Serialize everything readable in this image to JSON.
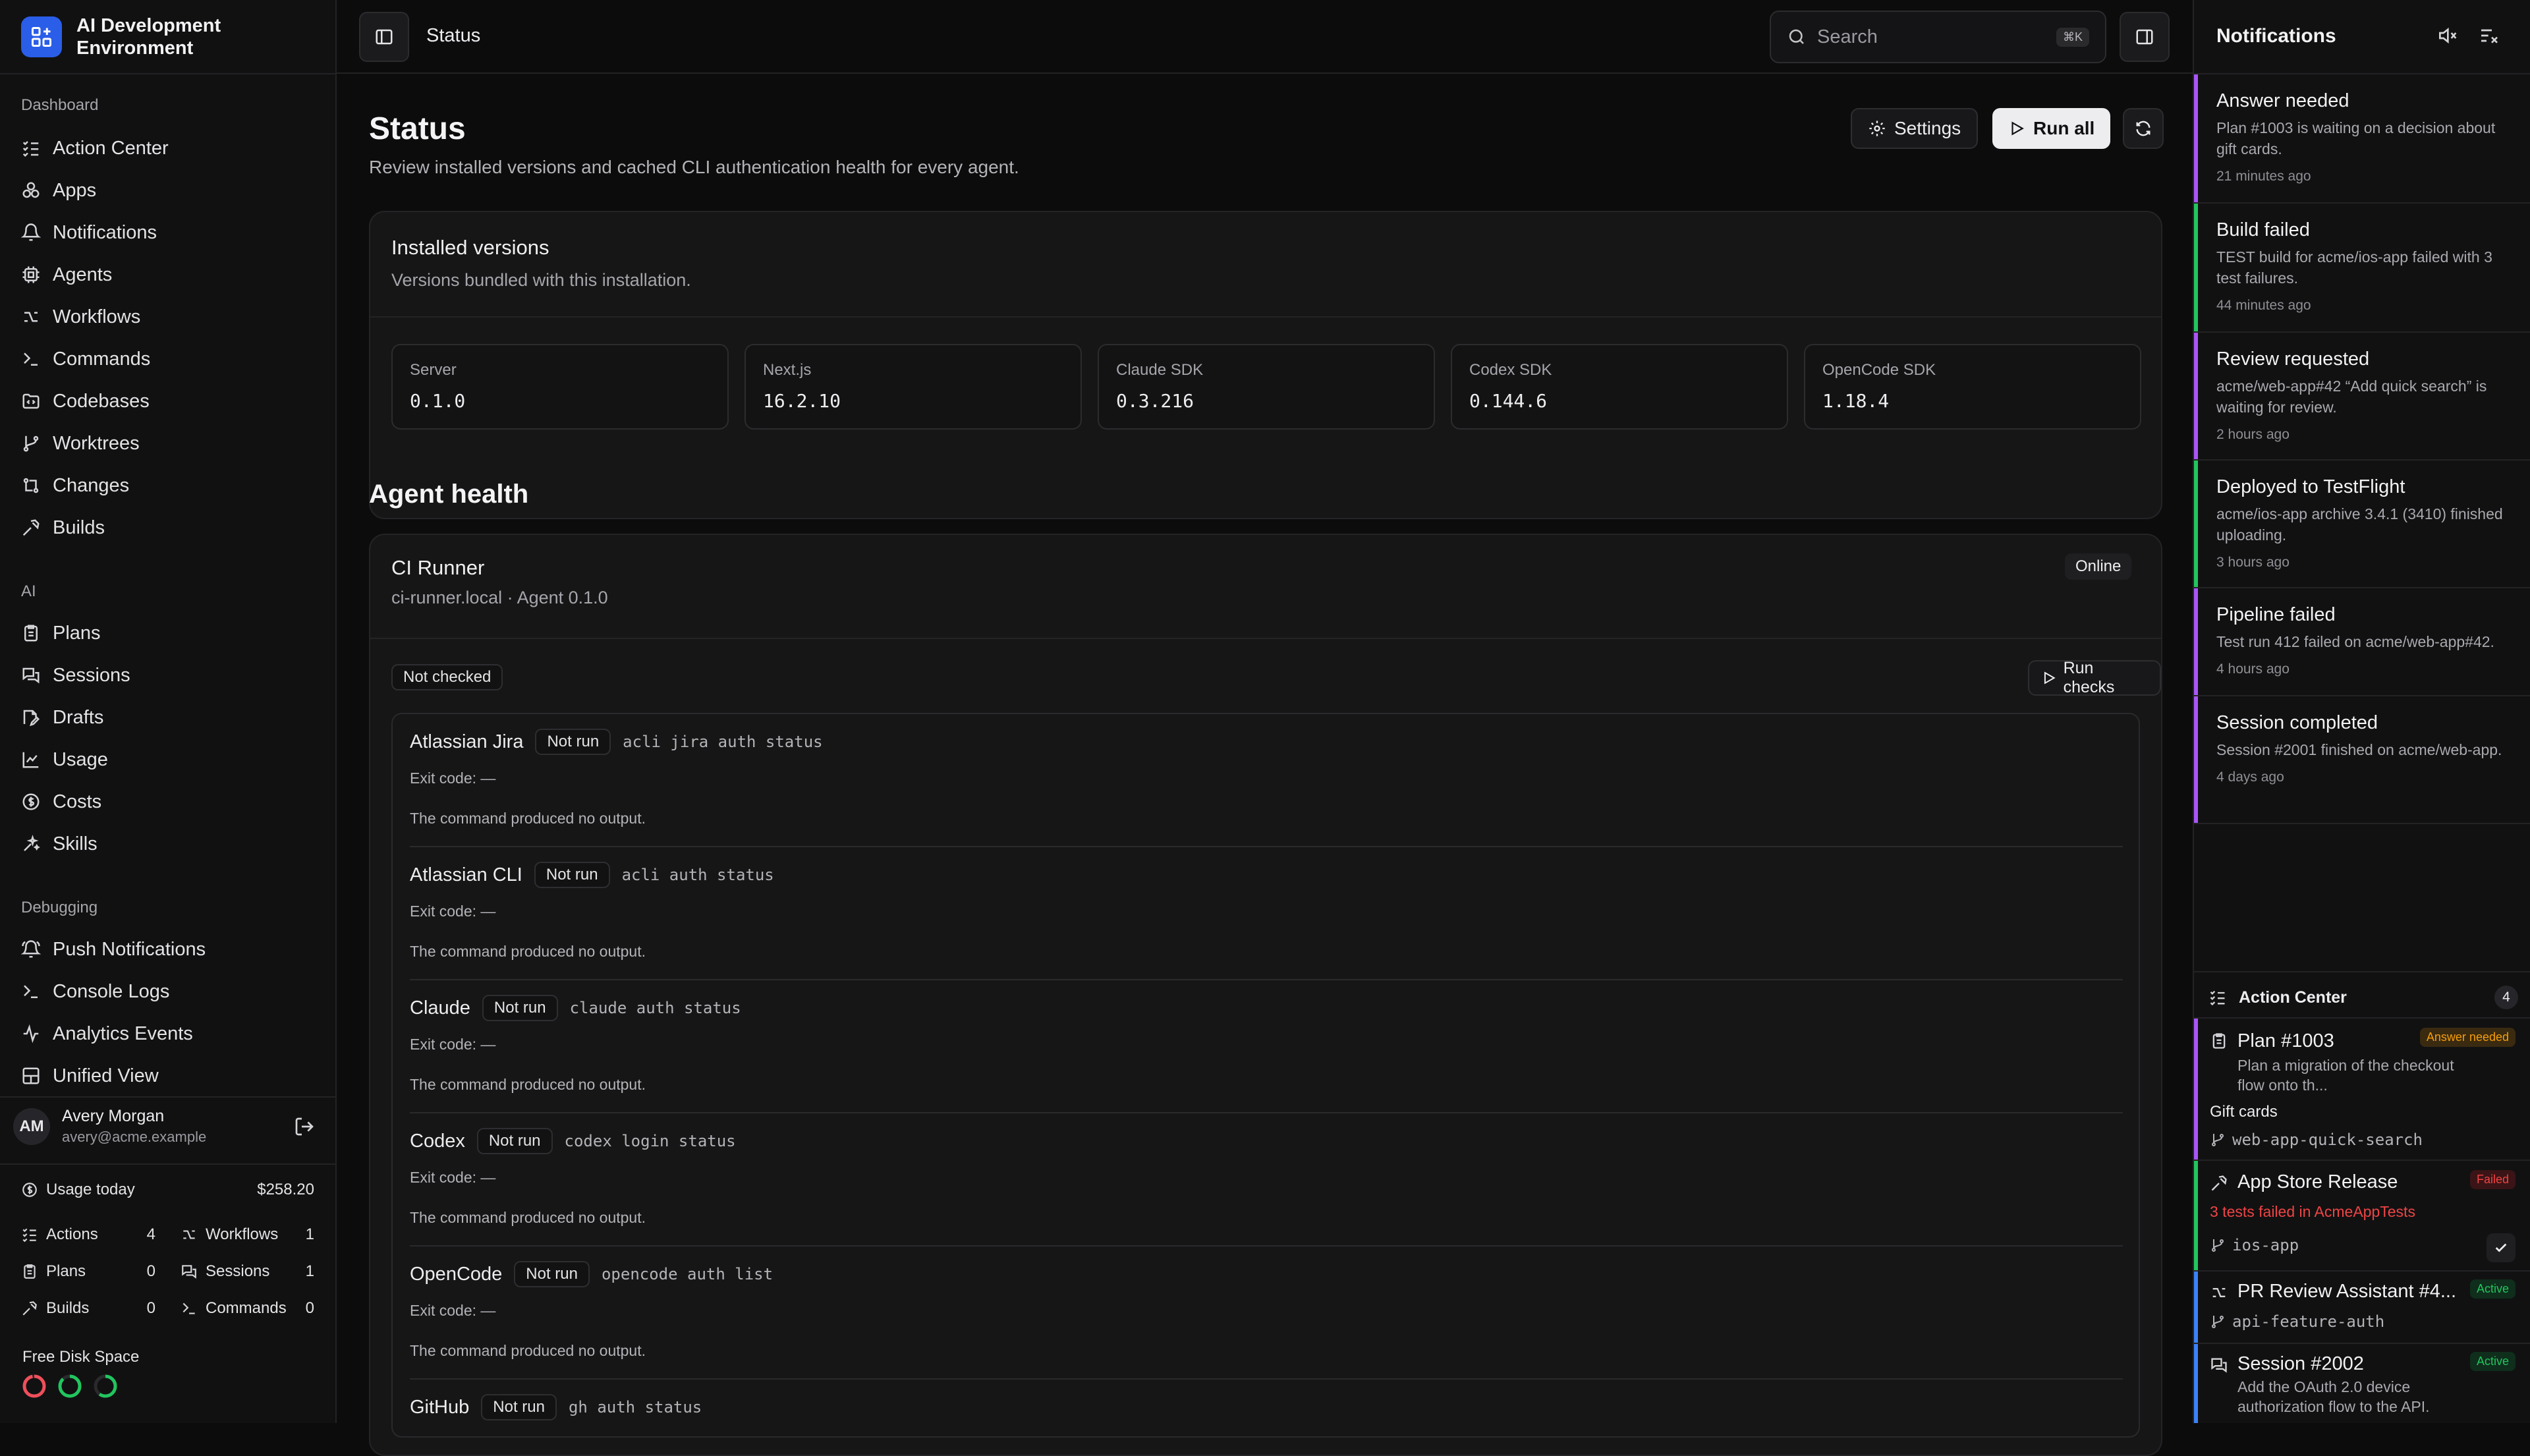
{
  "app": {
    "name": "AI Development Environment"
  },
  "sidebar": {
    "sections": [
      {
        "label": "Dashboard",
        "items": [
          {
            "label": "Action Center",
            "icon": "list-checks-icon"
          },
          {
            "label": "Apps",
            "icon": "apps-icon"
          },
          {
            "label": "Notifications",
            "icon": "bell-icon"
          },
          {
            "label": "Agents",
            "icon": "cpu-icon"
          },
          {
            "label": "Workflows",
            "icon": "workflow-icon"
          },
          {
            "label": "Commands",
            "icon": "terminal-icon"
          },
          {
            "label": "Codebases",
            "icon": "folder-code-icon"
          },
          {
            "label": "Worktrees",
            "icon": "git-branch-icon"
          },
          {
            "label": "Changes",
            "icon": "git-compare-icon"
          },
          {
            "label": "Builds",
            "icon": "hammer-icon"
          }
        ]
      },
      {
        "label": "AI",
        "items": [
          {
            "label": "Plans",
            "icon": "clipboard-icon"
          },
          {
            "label": "Sessions",
            "icon": "messages-icon"
          },
          {
            "label": "Drafts",
            "icon": "file-edit-icon"
          },
          {
            "label": "Usage",
            "icon": "chart-icon"
          },
          {
            "label": "Costs",
            "icon": "dollar-circle-icon"
          },
          {
            "label": "Skills",
            "icon": "sparkles-icon"
          }
        ]
      },
      {
        "label": "Debugging",
        "items": [
          {
            "label": "Push Notifications",
            "icon": "bell-ring-icon"
          },
          {
            "label": "Console Logs",
            "icon": "terminal-icon"
          },
          {
            "label": "Analytics Events",
            "icon": "activity-icon"
          },
          {
            "label": "Unified View",
            "icon": "layout-icon"
          }
        ]
      }
    ],
    "user": {
      "initials": "AM",
      "name": "Avery Morgan",
      "email": "avery@acme.example"
    },
    "usage": {
      "label": "Usage today",
      "amount": "$258.20",
      "stats": [
        {
          "label": "Actions",
          "value": "4"
        },
        {
          "label": "Workflows",
          "value": "1"
        },
        {
          "label": "Plans",
          "value": "0"
        },
        {
          "label": "Sessions",
          "value": "1"
        },
        {
          "label": "Builds",
          "value": "0"
        },
        {
          "label": "Commands",
          "value": "0"
        }
      ]
    },
    "disk": {
      "label": "Free Disk Space",
      "rings": [
        {
          "fraction": 0.97,
          "color": "#ef4f5a"
        },
        {
          "fraction": 0.88,
          "color": "#22c55e"
        },
        {
          "fraction": 0.6,
          "color": "#22c55e"
        }
      ]
    }
  },
  "header": {
    "breadcrumb": "Status",
    "search_placeholder": "Search",
    "shortcut": "⌘K"
  },
  "page": {
    "title": "Status",
    "subtitle": "Review installed versions and cached CLI authentication health for every agent.",
    "settings_label": "Settings",
    "run_all_label": "Run all"
  },
  "versions": {
    "title": "Installed versions",
    "subtitle": "Versions bundled with this installation.",
    "items": [
      {
        "label": "Server",
        "value": "0.1.0"
      },
      {
        "label": "Next.js",
        "value": "16.2.10"
      },
      {
        "label": "Claude SDK",
        "value": "0.3.216"
      },
      {
        "label": "Codex SDK",
        "value": "0.144.6"
      },
      {
        "label": "OpenCode SDK",
        "value": "1.18.4"
      }
    ]
  },
  "health": {
    "title": "Agent health",
    "agent": {
      "name": "CI Runner",
      "meta": "ci-runner.local · Agent 0.1.0",
      "status": "Online"
    },
    "check_status": "Not checked",
    "run_checks_label": "Run checks",
    "checks": [
      {
        "name": "Atlassian Jira",
        "status": "Not run",
        "command": "acli jira auth status",
        "exit": "Exit code: —",
        "output": "The command produced no output."
      },
      {
        "name": "Atlassian CLI",
        "status": "Not run",
        "command": "acli auth status",
        "exit": "Exit code: —",
        "output": "The command produced no output."
      },
      {
        "name": "Claude",
        "status": "Not run",
        "command": "claude auth status",
        "exit": "Exit code: —",
        "output": "The command produced no output."
      },
      {
        "name": "Codex",
        "status": "Not run",
        "command": "codex login status",
        "exit": "Exit code: —",
        "output": "The command produced no output."
      },
      {
        "name": "OpenCode",
        "status": "Not run",
        "command": "opencode auth list",
        "exit": "Exit code: —",
        "output": "The command produced no output."
      },
      {
        "name": "GitHub",
        "status": "Not run",
        "command": "gh auth status",
        "exit": "",
        "output": ""
      }
    ]
  },
  "notifications": {
    "title": "Notifications",
    "items": [
      {
        "title": "Answer needed",
        "body": "Plan #1003 is waiting on a decision about gift cards.",
        "time": "21 minutes ago",
        "color": "#a855f7"
      },
      {
        "title": "Build failed",
        "body": "TEST build for acme/ios-app failed with 3 test failures.",
        "time": "44 minutes ago",
        "color": "#22c55e"
      },
      {
        "title": "Review requested",
        "body": "acme/web-app#42 “Add quick search” is waiting for review.",
        "time": "2 hours ago",
        "color": "#a855f7"
      },
      {
        "title": "Deployed to TestFlight",
        "body": "acme/ios-app archive 3.4.1 (3410) finished uploading.",
        "time": "3 hours ago",
        "color": "#22c55e"
      },
      {
        "title": "Pipeline failed",
        "body": "Test run 412 failed on acme/web-app#42.",
        "time": "4 hours ago",
        "color": "#a855f7"
      },
      {
        "title": "Session completed",
        "body": "Session #2001 finished on acme/web-app.",
        "time": "4 days ago",
        "color": "#a855f7"
      }
    ]
  },
  "action_center": {
    "title": "Action Center",
    "count": "4",
    "items": [
      {
        "title": "Plan #1003",
        "badge": "Answer needed",
        "desc": "Plan a migration of the checkout flow onto th...",
        "extra": "Gift cards",
        "branch": "web-app-quick-search",
        "color": "#a855f7",
        "badge_color": "#f59e0b"
      },
      {
        "title": "App Store Release",
        "badge": "Failed",
        "desc": "3 tests failed in AcmeAppTests",
        "branch": "ios-app",
        "color": "#22c55e",
        "badge_color": "#ef4444"
      },
      {
        "title": "PR Review Assistant #4...",
        "badge": "Active",
        "branch": "api-feature-auth",
        "color": "#3b82f6",
        "badge_color": "#22c55e"
      },
      {
        "title": "Session #2002",
        "badge": "Active",
        "desc": "Add the OAuth 2.0 device authorization flow to the API.",
        "color": "#3b82f6",
        "badge_color": "#22c55e"
      }
    ]
  }
}
